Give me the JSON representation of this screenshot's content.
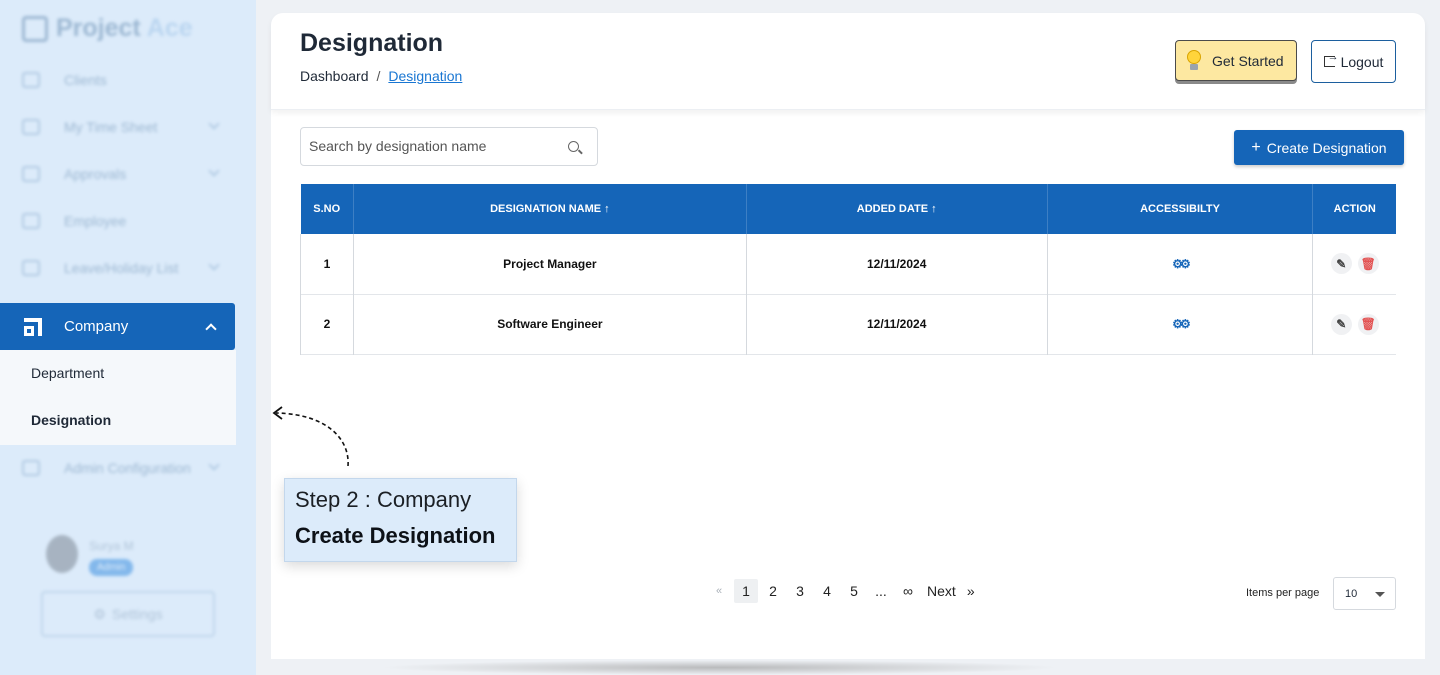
{
  "app": {
    "logo_text_1": "Project",
    "logo_text_2": "Ace",
    "brand_color": "#1565b8"
  },
  "sidebar": {
    "items": [
      {
        "label": "Clients",
        "icon": "clients-icon"
      },
      {
        "label": "My Time Sheet",
        "icon": "timesheet-icon"
      },
      {
        "label": "Approvals",
        "icon": "calendar-icon"
      },
      {
        "label": "Employee",
        "icon": "employee-icon"
      },
      {
        "label": "Leave/Holiday List",
        "icon": "leave-icon"
      },
      {
        "label": "Company",
        "icon": "company-icon",
        "active": true
      },
      {
        "label": "Admin Configuration",
        "icon": "admin-icon"
      }
    ],
    "company_submenu": [
      {
        "label": "Department"
      },
      {
        "label": "Designation",
        "active": true
      }
    ],
    "user": {
      "name": "Surya M",
      "role": "Admin"
    },
    "settings_label": "Settings"
  },
  "header": {
    "title": "Designation",
    "breadcrumb": [
      "Dashboard",
      "/",
      "Designation"
    ],
    "get_started_label": "Get Started",
    "logout_label": "Logout"
  },
  "toolbar": {
    "search_placeholder": "Search by designation name",
    "create_label": "Create Designation"
  },
  "table": {
    "columns": [
      "S.NO",
      "DESIGNATION NAME ↑",
      "ADDED DATE ↑",
      "ACCESSIBILTY",
      "ACTION"
    ],
    "rows": [
      {
        "sno": "1",
        "name": "Project Manager",
        "date": "12/11/2024"
      },
      {
        "sno": "2",
        "name": "Software Engineer",
        "date": "12/11/2024"
      }
    ]
  },
  "pagination": {
    "first": "«",
    "pages": [
      "1",
      "2",
      "3",
      "4",
      "5",
      "...",
      "∞"
    ],
    "current": "1",
    "next": "Next",
    "last": "»",
    "items_per_page_label": "Items per page",
    "items_per_page": "10"
  },
  "tour": {
    "step": "Step 2  : Company",
    "action": "Create Designation"
  }
}
